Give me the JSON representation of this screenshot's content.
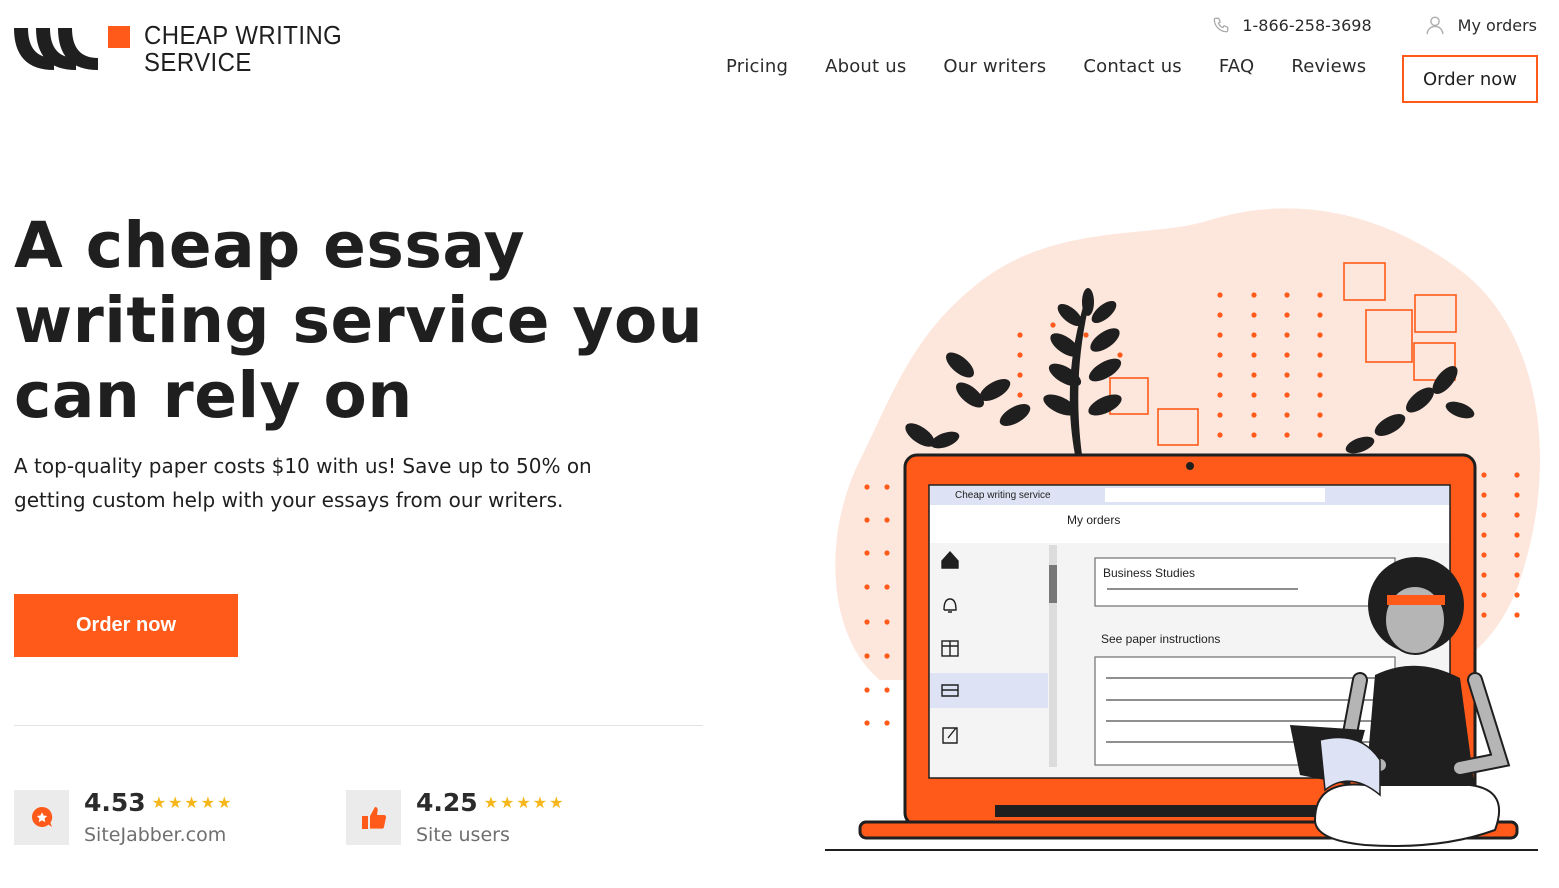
{
  "brand": {
    "name_line1": "CHEAP WRITING",
    "name_line2": "SERVICE"
  },
  "top_bar": {
    "phone": "1-866-258-3698",
    "my_orders": "My orders"
  },
  "nav": {
    "items": [
      "Pricing",
      "About us",
      "Our writers",
      "Contact us",
      "FAQ",
      "Reviews"
    ],
    "order_button": "Order now"
  },
  "hero": {
    "title": "A cheap essay writing service you can rely on",
    "subtitle": "A top-quality paper costs $10 with us! Save up to 50% on getting custom help with your essays from our writers.",
    "cta": "Order now"
  },
  "ratings": [
    {
      "score": "4.53",
      "stars": 5,
      "source": "SiteJabber.com",
      "icon": "sitejabber-icon"
    },
    {
      "score": "4.25",
      "stars": 5,
      "source": "Site users",
      "icon": "thumbs-up-icon"
    }
  ],
  "illustration": {
    "app_title": "Cheap writing service",
    "page_title": "My orders",
    "order_subject": "Business Studies",
    "instructions_label": "See paper instructions"
  },
  "colors": {
    "accent": "#ff5a1a",
    "peach": "#fde6dc",
    "dark": "#1f1f1f",
    "star": "#f6b71c"
  },
  "icons": {
    "phone": "phone-icon",
    "user": "user-icon"
  }
}
